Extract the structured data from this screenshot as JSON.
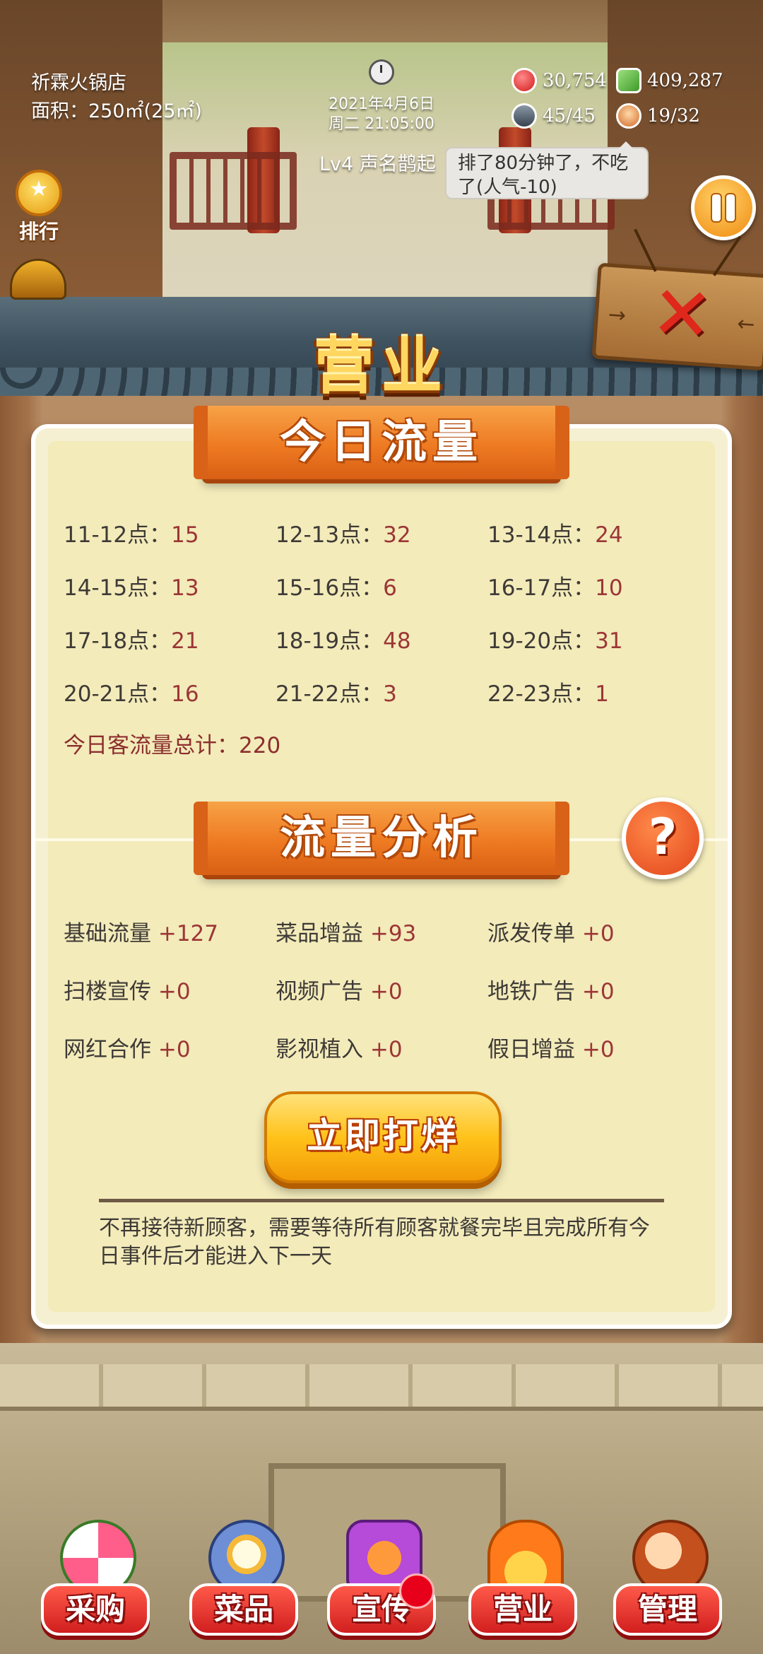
{
  "hud": {
    "shop_name": "祈霖火锅店",
    "area": "面积：250㎡(25㎡)",
    "date": "2021年4月6日",
    "time": "周二 21:05:00",
    "level": "Lv4 声名鹊起",
    "popularity": "30,754",
    "cash": "409,287",
    "seats": "45/45",
    "staff": "19/32",
    "bubble": "排了80分钟了，不吃了(人气-10)",
    "rank_label": "排行"
  },
  "panel": {
    "title": "营业",
    "today_traffic_title": "今日流量",
    "hours": [
      {
        "label": "11-12点：",
        "value": "15"
      },
      {
        "label": "12-13点：",
        "value": "32"
      },
      {
        "label": "13-14点：",
        "value": "24"
      },
      {
        "label": "14-15点：",
        "value": "13"
      },
      {
        "label": "15-16点：",
        "value": "6"
      },
      {
        "label": "16-17点：",
        "value": "10"
      },
      {
        "label": "17-18点：",
        "value": "21"
      },
      {
        "label": "18-19点：",
        "value": "48"
      },
      {
        "label": "19-20点：",
        "value": "31"
      },
      {
        "label": "20-21点：",
        "value": "16"
      },
      {
        "label": "21-22点：",
        "value": "3"
      },
      {
        "label": "22-23点：",
        "value": "1"
      }
    ],
    "total": "今日客流量总计：220",
    "analysis_title": "流量分析",
    "help": "?",
    "analysis": [
      {
        "label": "基础流量 ",
        "value": "+127"
      },
      {
        "label": "菜品增益 ",
        "value": "+93"
      },
      {
        "label": "派发传单 ",
        "value": "+0"
      },
      {
        "label": "扫楼宣传 ",
        "value": "+0"
      },
      {
        "label": "视频广告 ",
        "value": "+0"
      },
      {
        "label": "地铁广告 ",
        "value": "+0"
      },
      {
        "label": "网红合作 ",
        "value": "+0"
      },
      {
        "label": "影视植入 ",
        "value": "+0"
      },
      {
        "label": "假日增益 ",
        "value": "+0"
      }
    ],
    "close_now": "立即打烊",
    "note": "不再接待新顾客，需要等待所有顾客就餐完毕且完成所有今日事件后才能进入下一天"
  },
  "nav": {
    "purchase": "采购",
    "dishes": "菜品",
    "promote": "宣传",
    "business": "营业",
    "manage": "管理"
  },
  "colors": {
    "panel_bg": "#f3ebba",
    "ribbon": "#ee7a22",
    "value_text": "#9c3636",
    "nav_button": "#d11f1f"
  }
}
